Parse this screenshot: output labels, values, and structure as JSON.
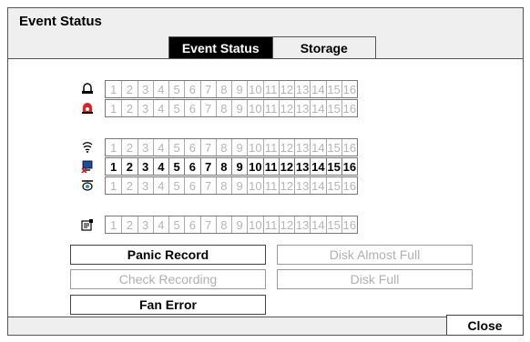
{
  "window": {
    "title": "Event Status"
  },
  "tabs": [
    {
      "label": "Event Status",
      "active": true
    },
    {
      "label": "Storage",
      "active": false
    }
  ],
  "channels": [
    "1",
    "2",
    "3",
    "4",
    "5",
    "6",
    "7",
    "8",
    "9",
    "10",
    "11",
    "12",
    "13",
    "14",
    "15",
    "16"
  ],
  "rows": [
    {
      "icon": "alarm-in-icon",
      "active": false
    },
    {
      "icon": "alarm-out-icon",
      "active": false
    },
    {
      "icon": "motion-icon",
      "active": false
    },
    {
      "icon": "video-loss-icon",
      "active": true
    },
    {
      "icon": "tamper-icon",
      "active": false
    },
    {
      "icon": "text-in-icon",
      "active": false
    }
  ],
  "status_buttons": [
    {
      "label": "Panic Record",
      "active": true
    },
    {
      "label": "Disk Almost Full",
      "active": false
    },
    {
      "label": "Check Recording",
      "active": false
    },
    {
      "label": "Disk Full",
      "active": false
    },
    {
      "label": "Fan Error",
      "active": true
    }
  ],
  "close_label": "Close"
}
